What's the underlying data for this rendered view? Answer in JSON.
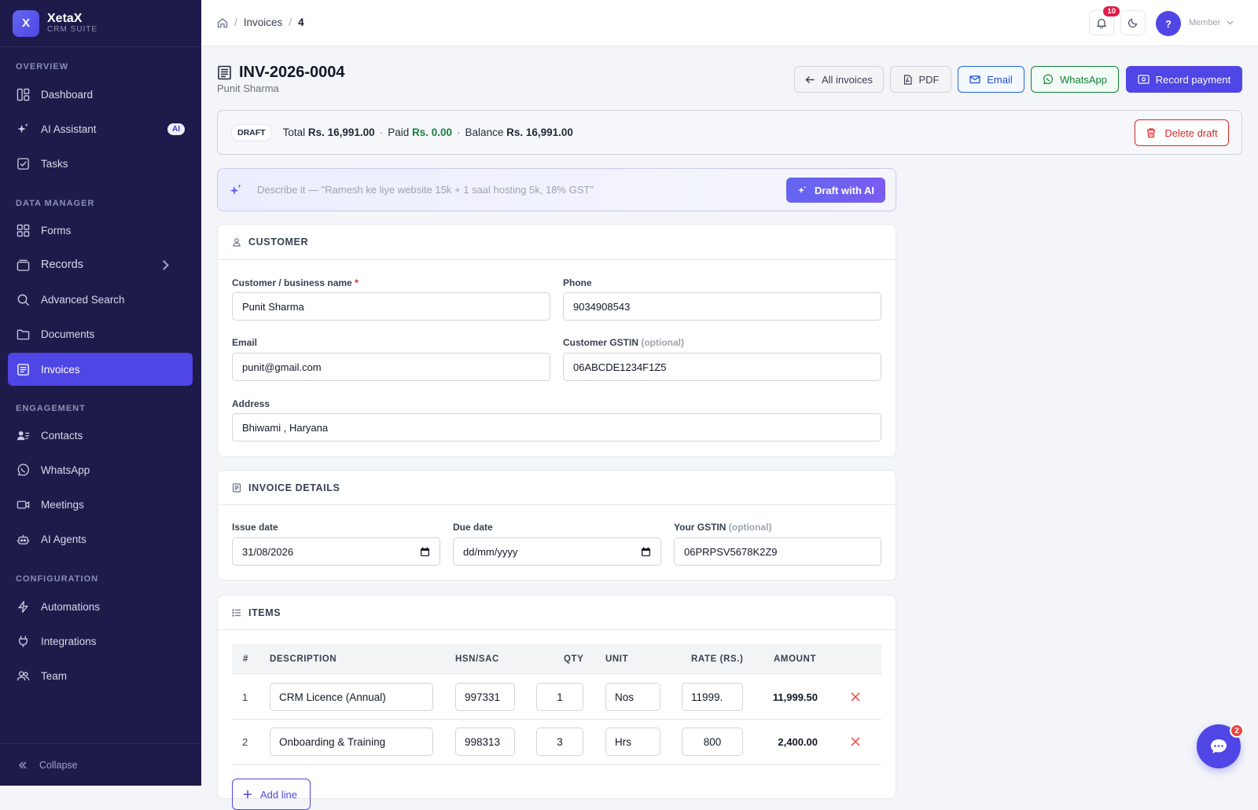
{
  "brand": {
    "name": "XetaX",
    "subtitle": "CRM SUITE",
    "logo_letter": "X"
  },
  "sidebar": {
    "sections": [
      "OVERVIEW",
      "DATA MANAGER",
      "ENGAGEMENT",
      "CONFIGURATION"
    ],
    "items": [
      {
        "label": "Dashboard",
        "icon": "dashboard-icon"
      },
      {
        "label": "AI Assistant",
        "icon": "sparkles-icon",
        "badge": "AI"
      },
      {
        "label": "Tasks",
        "icon": "checkbox-icon"
      },
      {
        "label": "Forms",
        "icon": "forms-icon"
      },
      {
        "label": "Records",
        "icon": "records-icon"
      },
      {
        "label": "Advanced Search",
        "icon": "search-icon"
      },
      {
        "label": "Documents",
        "icon": "folder-icon"
      },
      {
        "label": "Invoices",
        "icon": "invoice-icon"
      },
      {
        "label": "Contacts",
        "icon": "contacts-icon"
      },
      {
        "label": "WhatsApp",
        "icon": "whatsapp-icon"
      },
      {
        "label": "Meetings",
        "icon": "video-icon"
      },
      {
        "label": "AI Agents",
        "icon": "robot-icon"
      },
      {
        "label": "Automations",
        "icon": "bolt-icon"
      },
      {
        "label": "Integrations",
        "icon": "plug-icon"
      },
      {
        "label": "Team",
        "icon": "team-icon"
      }
    ],
    "active": "Invoices",
    "collapse_label": "Collapse"
  },
  "topbar": {
    "breadcrumb": [
      "Invoices",
      "4"
    ],
    "notification_count": "10",
    "avatar_letter": "?",
    "role": "Member"
  },
  "invoice": {
    "number": "INV-2026-0004",
    "customer": "Punit Sharma",
    "actions": {
      "all": "All invoices",
      "pdf": "PDF",
      "email": "Email",
      "whatsapp": "WhatsApp",
      "record": "Record payment"
    },
    "status": "DRAFT",
    "total_label": "Total",
    "total": "Rs. 16,991.00",
    "paid_label": "Paid",
    "paid": "Rs. 0.00",
    "balance_label": "Balance",
    "balance": "Rs. 16,991.00",
    "delete_label": "Delete draft"
  },
  "ai": {
    "placeholder": "Describe it — \"Ramesh ke liye website 15k + 1 saal hosting 5k, 18% GST\"",
    "button": "Draft with AI"
  },
  "customer_card": {
    "title": "CUSTOMER",
    "name_label": "Customer / business name",
    "name": "Punit Sharma",
    "phone_label": "Phone",
    "phone": "9034908543",
    "email_label": "Email",
    "email": "punit@gmail.com",
    "gstin_label": "Customer GSTIN",
    "gstin_opt": "(optional)",
    "gstin": "06ABCDE1234F1Z5",
    "address_label": "Address",
    "address": "Bhiwami , Haryana"
  },
  "details_card": {
    "title": "INVOICE DETAILS",
    "issue_label": "Issue date",
    "issue": "31/08/2026",
    "due_label": "Due date",
    "due": "dd/mm/yyyy",
    "gstin_label": "Your GSTIN",
    "gstin_opt": "(optional)",
    "gstin": "06PRPSV5678K2Z9"
  },
  "items_card": {
    "title": "ITEMS",
    "columns": [
      "#",
      "DESCRIPTION",
      "HSN/SAC",
      "QTY",
      "UNIT",
      "RATE (RS.)",
      "AMOUNT"
    ],
    "rows": [
      {
        "n": "1",
        "desc": "CRM Licence (Annual)",
        "hsn": "997331",
        "qty": "1",
        "unit": "Nos",
        "rate": "11999.",
        "amount": "11,999.50"
      },
      {
        "n": "2",
        "desc": "Onboarding & Training",
        "hsn": "998313",
        "qty": "3",
        "unit": "Hrs",
        "rate": "800",
        "amount": "2,400.00"
      }
    ],
    "add_label": "Add line"
  },
  "chat": {
    "badge": "2"
  },
  "colors": {
    "sidebar": "#1e1b4b",
    "accent": "#4f46e5",
    "danger": "#dc2626",
    "success": "#15803d"
  }
}
